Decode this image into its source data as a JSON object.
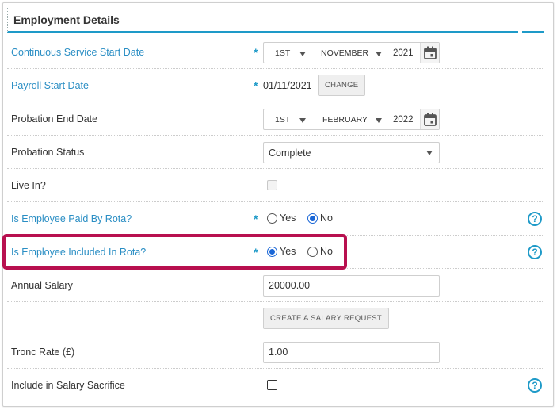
{
  "section": {
    "title": "Employment Details"
  },
  "colors": {
    "accent": "#1e9ac8",
    "label_link": "#2a8ec4",
    "highlight": "#b8104f",
    "radio_checked": "#1a66d6"
  },
  "rows": {
    "continuous_service": {
      "label": "Continuous Service Start Date",
      "day": "1ST",
      "month": "NOVEMBER",
      "year": "2021",
      "icon": "calendar-icon"
    },
    "payroll_start": {
      "label": "Payroll Start Date",
      "value": "01/11/2021",
      "button": "CHANGE"
    },
    "probation_end": {
      "label": "Probation End Date",
      "day": "1ST",
      "month": "FEBRUARY",
      "year": "2022",
      "icon": "calendar-icon"
    },
    "probation_status": {
      "label": "Probation Status",
      "selected": "Complete"
    },
    "live_in": {
      "label": "Live In?",
      "checked": false,
      "disabled": true
    },
    "paid_by_rota": {
      "label": "Is Employee Paid By Rota?",
      "yes": "Yes",
      "no": "No",
      "selected": "No"
    },
    "included_in_rota": {
      "label": "Is Employee Included In Rota?",
      "yes": "Yes",
      "no": "No",
      "selected": "Yes"
    },
    "annual_salary": {
      "label": "Annual Salary",
      "value": "20000.00"
    },
    "salary_request": {
      "button": "CREATE A SALARY REQUEST"
    },
    "tronc_rate": {
      "label": "Tronc Rate (£)",
      "value": "1.00"
    },
    "salary_sacrifice": {
      "label": "Include in Salary Sacrifice",
      "checked": false
    }
  },
  "required_mark": "*",
  "help_mark": "?"
}
